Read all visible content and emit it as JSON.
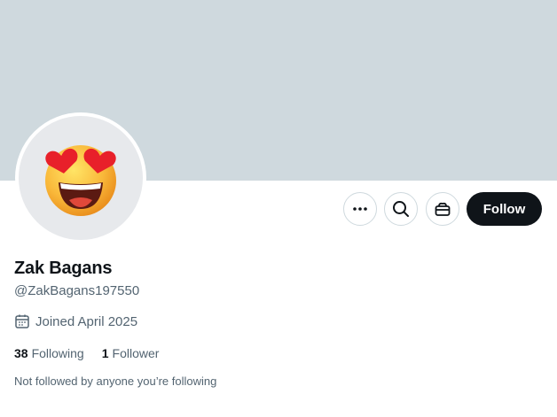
{
  "profile": {
    "display_name": "Zak Bagans",
    "handle": "@ZakBagans197550",
    "avatar_icon": "heart-eyes-emoji",
    "joined": "Joined April 2025",
    "following_count": "38",
    "following_label": "Following",
    "followers_count": "1",
    "followers_label": "Follower",
    "followed_note": "Not followed by anyone you’re following"
  },
  "actions": {
    "more_icon": "more-icon",
    "search_icon": "search-icon",
    "subscribe_icon": "subscription-icon",
    "follow_label": "Follow"
  },
  "colors": {
    "banner": "#cfd9de",
    "primary_text": "#0f1419",
    "secondary_text": "#536471",
    "follow_bg": "#0f1419"
  }
}
